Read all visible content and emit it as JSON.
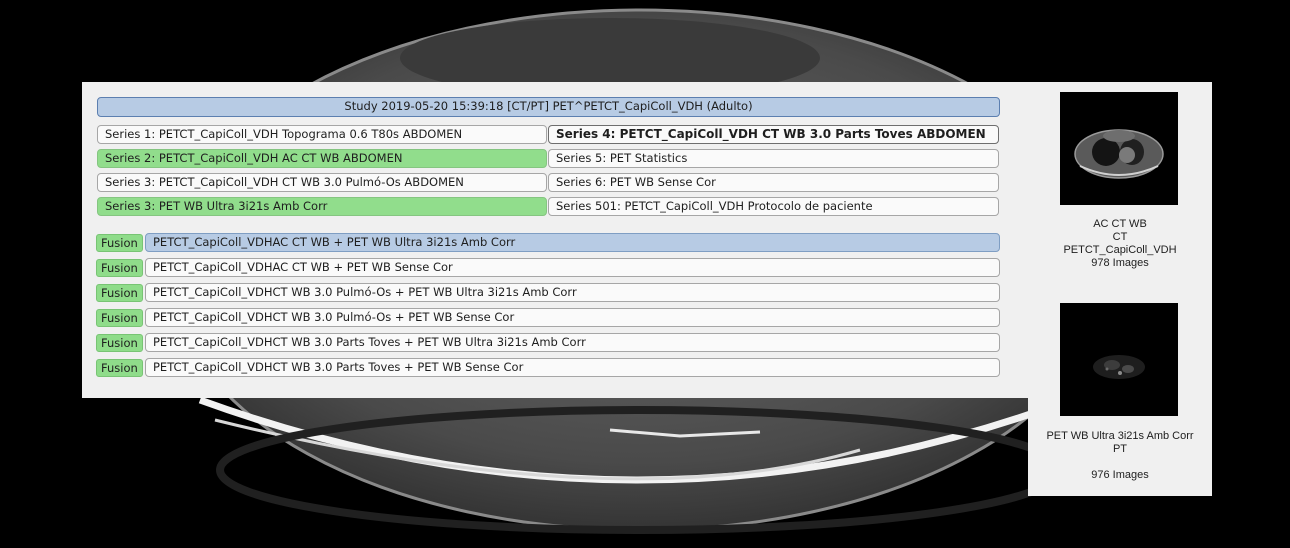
{
  "study": {
    "label": "Study 2019-05-20 15:39:18 [CT/PT] PET^PETCT_CapiColl_VDH (Adulto)"
  },
  "series_left": [
    {
      "label": "Series 1: PETCT_CapiColl_VDH Topograma  0.6  T80s ABDOMEN",
      "state": "normal"
    },
    {
      "label": "Series 2: PETCT_CapiColl_VDH AC CT WB ABDOMEN",
      "state": "selected"
    },
    {
      "label": "Series 3: PETCT_CapiColl_VDH CT WB  3.0  Pulmó-Os ABDOMEN",
      "state": "normal"
    },
    {
      "label": "Series 3:  PET WB Ultra 3i21s Amb Corr",
      "state": "selected"
    }
  ],
  "series_right": [
    {
      "label": "Series 4: PETCT_CapiColl_VDH CT WB  3.0  Parts Toves ABDOMEN",
      "state": "bold"
    },
    {
      "label": "Series 5:  PET Statistics",
      "state": "normal"
    },
    {
      "label": "Series 6:  PET WB Sense Cor",
      "state": "normal"
    },
    {
      "label": "Series 501: PETCT_CapiColl_VDH Protocolo de paciente",
      "state": "normal"
    }
  ],
  "fusion_tag": "Fusion",
  "fusions": [
    {
      "label": "PETCT_CapiColl_VDHAC CT WB + PET WB Ultra 3i21s Amb Corr",
      "state": "highlighted"
    },
    {
      "label": "PETCT_CapiColl_VDHAC CT WB + PET WB Sense Cor",
      "state": "normal"
    },
    {
      "label": "PETCT_CapiColl_VDHCT WB  3.0  Pulmó-Os + PET WB Ultra 3i21s Amb Corr",
      "state": "normal"
    },
    {
      "label": "PETCT_CapiColl_VDHCT WB  3.0  Pulmó-Os + PET WB Sense Cor",
      "state": "normal"
    },
    {
      "label": "PETCT_CapiColl_VDHCT WB  3.0  Parts Toves + PET WB Ultra 3i21s Amb Corr",
      "state": "normal"
    },
    {
      "label": "PETCT_CapiColl_VDHCT WB  3.0  Parts Toves + PET WB Sense Cor",
      "state": "normal"
    }
  ],
  "thumbnails": [
    {
      "line1": "AC CT WB",
      "line2": "CT",
      "line3": "PETCT_CapiColl_VDH",
      "line4": "978 Images"
    },
    {
      "line1": "PET WB Ultra 3i21s Amb Corr",
      "line2": "PT",
      "line3": "",
      "line4": "976 Images"
    }
  ]
}
